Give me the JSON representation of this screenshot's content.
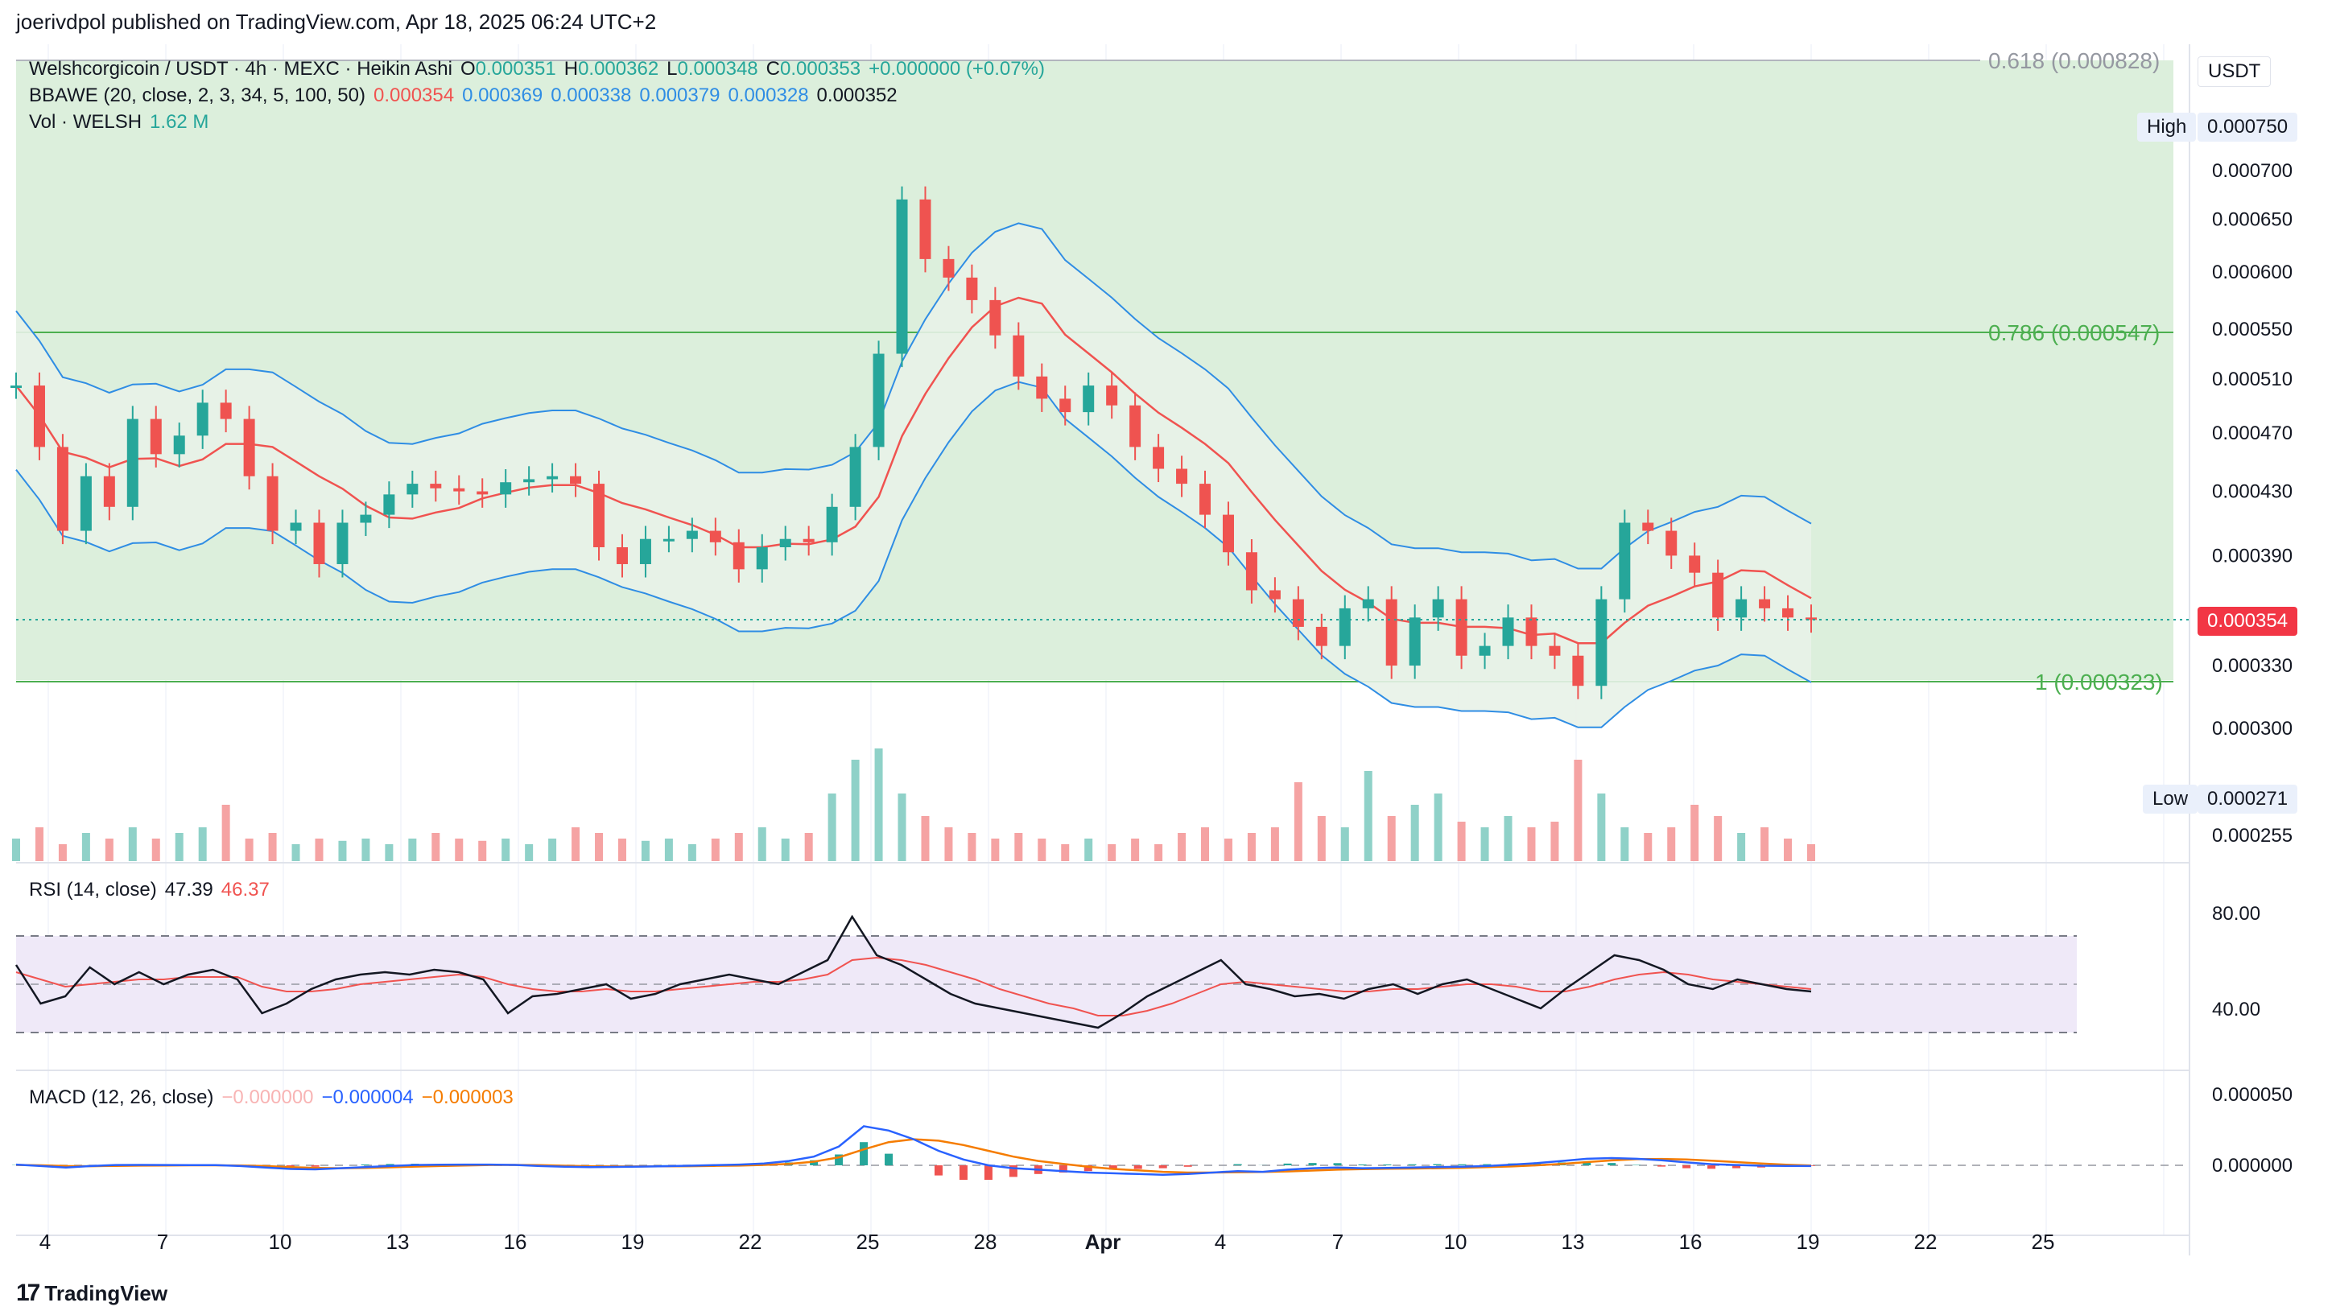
{
  "header": {
    "published_line": "joerivdpol published on TradingView.com, Apr 18, 2025 06:24 UTC+2"
  },
  "currency_button": "USDT",
  "footer": {
    "brand": "TradingView",
    "logo_glyph": "17"
  },
  "legend_main": {
    "symbol": "Welshcorgicoin / USDT · 4h · MEXC · Heikin Ashi",
    "o_label": "O",
    "o_value": "0.000351",
    "h_label": "H",
    "h_value": "0.000362",
    "l_label": "L",
    "l_value": "0.000348",
    "c_label": "C",
    "c_value": "0.000353",
    "change": "+0.000000 (+0.07%)"
  },
  "legend_bbawe": {
    "label": "BBAWE (20, close, 2, 3, 34, 5, 100, 50)",
    "v1": "0.000354",
    "v2": "0.000369",
    "v3": "0.000338",
    "v4": "0.000379",
    "v5": "0.000328",
    "v6": "0.000352"
  },
  "legend_vol": {
    "label": "Vol · WELSH",
    "value": "1.62 M"
  },
  "legend_rsi": {
    "label": "RSI (14, close)",
    "v1": "47.39",
    "v2": "46.37"
  },
  "legend_macd": {
    "label": "MACD (12, 26, close)",
    "v1": "−0.000000",
    "v2": "−0.000004",
    "v3": "−0.000003"
  },
  "fib_labels": {
    "f618": "0.618 (0.000828)",
    "f786": "0.786 (0.000547)",
    "f1": "1 (0.000323)"
  },
  "high_label": "High",
  "high_value": "0.000750",
  "low_label": "Low",
  "low_value": "0.000271",
  "last_price": "0.000354",
  "colors": {
    "up": "#26a69a",
    "down": "#ef5350",
    "fib_zone": "#dcefdc",
    "ma": "#f05350",
    "bb": "#2f8de4",
    "rsi_zone": "#efe9f8",
    "macd": "#2962ff",
    "signal": "#f57c00"
  },
  "chart_data": {
    "type": "candlestick",
    "price_axis_ticks": [
      "0.000700",
      "0.000650",
      "0.000600",
      "0.000550",
      "0.000510",
      "0.000470",
      "0.000430",
      "0.000390",
      "0.000330",
      "0.000300",
      "0.000255"
    ],
    "rsi_axis_ticks": [
      "80.00",
      "40.00"
    ],
    "macd_axis_ticks": [
      "0.000050",
      "0.000000"
    ],
    "time_axis_ticks": [
      "4",
      "7",
      "10",
      "13",
      "16",
      "19",
      "22",
      "25",
      "28",
      "Apr",
      "4",
      "7",
      "10",
      "13",
      "16",
      "19",
      "22",
      "25"
    ],
    "fib_levels": [
      {
        "ratio": 0.618,
        "price": 0.000828
      },
      {
        "ratio": 0.786,
        "price": 0.000547
      },
      {
        "ratio": 1,
        "price": 0.000323
      }
    ],
    "close_path": [
      0.000505,
      0.00046,
      0.000405,
      0.00044,
      0.00042,
      0.00048,
      0.000455,
      0.000468,
      0.000492,
      0.00048,
      0.00044,
      0.000405,
      0.00041,
      0.000385,
      0.00041,
      0.000415,
      0.000428,
      0.000435,
      0.000432,
      0.00043,
      0.000428,
      0.000436,
      0.000438,
      0.00044,
      0.000435,
      0.000395,
      0.000385,
      0.0004,
      0.0004,
      0.000405,
      0.000398,
      0.000382,
      0.000395,
      0.0004,
      0.000398,
      0.00042,
      0.00046,
      0.00053,
      0.00067,
      0.000612,
      0.000595,
      0.000575,
      0.000545,
      0.000512,
      0.000495,
      0.000485,
      0.000505,
      0.00049,
      0.00046,
      0.000445,
      0.000435,
      0.000415,
      0.000392,
      0.00037,
      0.000365,
      0.00035,
      0.00034,
      0.00036,
      0.000365,
      0.00033,
      0.000355,
      0.000365,
      0.000335,
      0.00034,
      0.000355,
      0.00034,
      0.000335,
      0.00032,
      0.000365,
      0.00041,
      0.000405,
      0.00039,
      0.00038,
      0.000355,
      0.000365,
      0.00036,
      0.000355,
      0.000354
    ],
    "volume_path": [
      0.2,
      0.3,
      0.15,
      0.25,
      0.2,
      0.3,
      0.2,
      0.25,
      0.3,
      0.5,
      0.2,
      0.25,
      0.15,
      0.2,
      0.18,
      0.2,
      0.15,
      0.2,
      0.25,
      0.2,
      0.18,
      0.2,
      0.15,
      0.2,
      0.3,
      0.25,
      0.2,
      0.18,
      0.2,
      0.15,
      0.2,
      0.25,
      0.3,
      0.2,
      0.25,
      0.6,
      0.9,
      1.0,
      0.6,
      0.4,
      0.3,
      0.25,
      0.2,
      0.25,
      0.2,
      0.15,
      0.2,
      0.15,
      0.2,
      0.15,
      0.25,
      0.3,
      0.2,
      0.25,
      0.3,
      0.7,
      0.4,
      0.3,
      0.8,
      0.4,
      0.5,
      0.6,
      0.35,
      0.3,
      0.4,
      0.3,
      0.35,
      0.9,
      0.6,
      0.3,
      0.25,
      0.3,
      0.5,
      0.4,
      0.25,
      0.3,
      0.2,
      0.15
    ],
    "rsi_path": [
      58,
      42,
      45,
      57,
      50,
      55,
      50,
      54,
      56,
      52,
      38,
      42,
      48,
      52,
      54,
      55,
      54,
      56,
      55,
      52,
      38,
      45,
      46,
      48,
      50,
      44,
      46,
      50,
      52,
      54,
      52,
      50,
      55,
      60,
      78,
      62,
      58,
      52,
      46,
      42,
      40,
      38,
      36,
      34,
      32,
      38,
      45,
      50,
      55,
      60,
      50,
      48,
      45,
      46,
      44,
      48,
      50,
      46,
      50,
      52,
      48,
      44,
      40,
      48,
      55,
      62,
      60,
      56,
      50,
      48,
      52,
      50,
      48,
      47
    ],
    "rsi_ma_path": [
      55,
      52,
      49,
      50,
      51,
      52,
      52,
      53,
      53,
      53,
      49,
      47,
      47,
      48,
      50,
      51,
      52,
      53,
      54,
      53,
      50,
      48,
      47,
      47,
      48,
      47,
      47,
      48,
      49,
      50,
      51,
      51,
      52,
      54,
      60,
      61,
      60,
      58,
      55,
      52,
      48,
      45,
      42,
      40,
      37,
      37,
      39,
      42,
      46,
      50,
      51,
      50,
      49,
      48,
      47,
      47,
      48,
      48,
      49,
      50,
      50,
      49,
      47,
      47,
      49,
      52,
      54,
      55,
      54,
      52,
      51,
      50,
      49,
      48
    ],
    "macd_path": [
      0.5,
      -0.5,
      -1.5,
      -0.5,
      0.2,
      0.3,
      0.2,
      0.1,
      0.1,
      -0.5,
      -1.5,
      -2.5,
      -2.8,
      -2,
      -1.2,
      -0.5,
      0.2,
      0.4,
      0.5,
      0.5,
      0.3,
      -0.5,
      -1,
      -1.2,
      -1.1,
      -0.9,
      -0.6,
      -0.3,
      0.1,
      0.5,
      1.2,
      3,
      6,
      13,
      27,
      24,
      18,
      10,
      4,
      0,
      -2,
      -3,
      -4,
      -5,
      -5.5,
      -6,
      -6.5,
      -6,
      -5,
      -4,
      -4.5,
      -3,
      -2,
      -1.5,
      -2,
      -1.8,
      -1.5,
      -1.2,
      -1,
      -0.5,
      0.5,
      1.5,
      3,
      4.5,
      5,
      4.5,
      3.5,
      2,
      0.8,
      0.2,
      -0.3,
      -0.4,
      -0.5
    ],
    "signal_path": [
      0.3,
      0,
      -0.5,
      -0.6,
      -0.4,
      -0.2,
      -0.1,
      0,
      0,
      -0.1,
      -0.5,
      -1.2,
      -1.8,
      -2,
      -1.8,
      -1.4,
      -0.9,
      -0.5,
      -0.1,
      0.2,
      0.3,
      0.1,
      -0.3,
      -0.6,
      -0.8,
      -0.8,
      -0.7,
      -0.6,
      -0.4,
      -0.2,
      0.3,
      1,
      2.5,
      5.5,
      11,
      16,
      18,
      17,
      14,
      10,
      6,
      3,
      1,
      -1,
      -2.5,
      -3.5,
      -4.5,
      -5,
      -5,
      -4.8,
      -4.6,
      -4.2,
      -3.6,
      -3,
      -2.6,
      -2.4,
      -2.2,
      -2,
      -1.7,
      -1.3,
      -0.8,
      0,
      1,
      2.2,
      3.4,
      4.2,
      4.4,
      4,
      3.2,
      2.2,
      1.2,
      0.4,
      -0.1
    ]
  }
}
